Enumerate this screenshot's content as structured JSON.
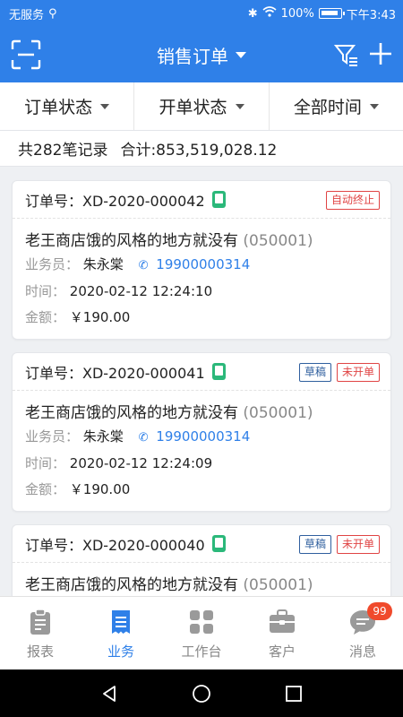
{
  "status_bar": {
    "carrier": "无服务",
    "usb_icon": "usb-icon",
    "battery": "100%",
    "time": "下午3:43"
  },
  "nav": {
    "title": "销售订单"
  },
  "filters": [
    {
      "label": "订单状态"
    },
    {
      "label": "开单状态"
    },
    {
      "label": "全部时间"
    }
  ],
  "summary": {
    "records": "共282笔记录",
    "total": "合计:853,519,028.12"
  },
  "orders": [
    {
      "order_no": "订单号：XD-2020-000042",
      "tags": [
        {
          "text": "自动终止",
          "color": "#e04444"
        }
      ],
      "customer": "老王商店饿的风格的地方就没有",
      "customer_code": "(050001)",
      "salesman_label": "业务员：",
      "salesman": "朱永棠",
      "phone": "19900000314",
      "time_label": "时间：",
      "time": "2020-02-12 12:24:10",
      "amount_label": "金额：",
      "amount": "￥190.00"
    },
    {
      "order_no": "订单号：XD-2020-000041",
      "tags": [
        {
          "text": "草稿",
          "color": "#2f5f9e"
        },
        {
          "text": "未开单",
          "color": "#e04444"
        }
      ],
      "customer": "老王商店饿的风格的地方就没有",
      "customer_code": "(050001)",
      "salesman_label": "业务员：",
      "salesman": "朱永棠",
      "phone": "19900000314",
      "time_label": "时间：",
      "time": "2020-02-12 12:24:09",
      "amount_label": "金额：",
      "amount": "￥190.00"
    },
    {
      "order_no": "订单号：XD-2020-000040",
      "tags": [
        {
          "text": "草稿",
          "color": "#2f5f9e"
        },
        {
          "text": "未开单",
          "color": "#e04444"
        }
      ],
      "customer": "老王商店饿的风格的地方就没有",
      "customer_code": "(050001)"
    }
  ],
  "tabs": [
    {
      "label": "报表",
      "icon": "report-icon"
    },
    {
      "label": "业务",
      "icon": "business-icon",
      "active": true
    },
    {
      "label": "工作台",
      "icon": "workbench-icon"
    },
    {
      "label": "客户",
      "icon": "customer-icon"
    },
    {
      "label": "消息",
      "icon": "message-icon",
      "badge": "99"
    }
  ],
  "colors": {
    "primary": "#2f80e8",
    "danger": "#e04444",
    "draft": "#2f5f9e",
    "badge": "#f04a2c",
    "pos": "#2bb87a"
  }
}
